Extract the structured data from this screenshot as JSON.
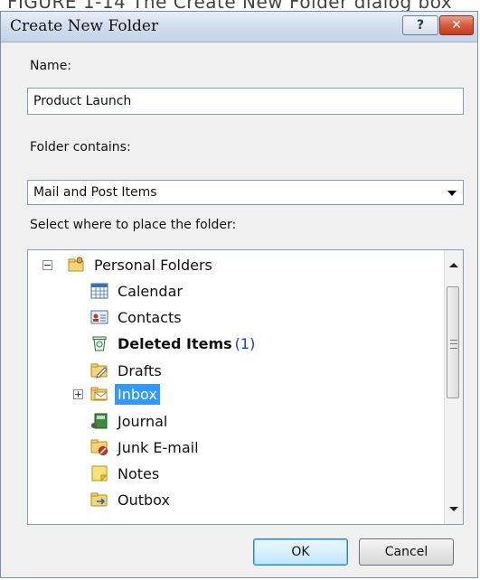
{
  "caption": "FIGURE 1-14 The Create New Folder dialog box",
  "window": {
    "title": "Create New Folder",
    "help_label": "?",
    "close_label": "✕"
  },
  "name_field": {
    "label": "Name:",
    "value": "Product Launch"
  },
  "folder_contains": {
    "label": "Folder contains:",
    "selected": "Mail and Post Items"
  },
  "location": {
    "label": "Select where to place the folder:",
    "tree": {
      "root": {
        "label": "Personal Folders",
        "icon": "personal-folders-icon",
        "expanded": true
      },
      "items": [
        {
          "label": "Calendar",
          "icon": "calendar-icon",
          "bold": false,
          "count": "",
          "selected": false,
          "expandable": false
        },
        {
          "label": "Contacts",
          "icon": "contacts-icon",
          "bold": false,
          "count": "",
          "selected": false,
          "expandable": false
        },
        {
          "label": "Deleted Items",
          "icon": "deleted-items-icon",
          "bold": true,
          "count": "(1)",
          "selected": false,
          "expandable": false
        },
        {
          "label": "Drafts",
          "icon": "drafts-icon",
          "bold": false,
          "count": "",
          "selected": false,
          "expandable": false
        },
        {
          "label": "Inbox",
          "icon": "inbox-icon",
          "bold": false,
          "count": "",
          "selected": true,
          "expandable": true
        },
        {
          "label": "Journal",
          "icon": "journal-icon",
          "bold": false,
          "count": "",
          "selected": false,
          "expandable": false
        },
        {
          "label": "Junk E-mail",
          "icon": "junk-email-icon",
          "bold": false,
          "count": "",
          "selected": false,
          "expandable": false
        },
        {
          "label": "Notes",
          "icon": "notes-icon",
          "bold": false,
          "count": "",
          "selected": false,
          "expandable": false
        },
        {
          "label": "Outbox",
          "icon": "outbox-icon",
          "bold": false,
          "count": "",
          "selected": false,
          "expandable": false
        }
      ]
    }
  },
  "buttons": {
    "ok": "OK",
    "cancel": "Cancel"
  },
  "colors": {
    "selection": "#3399ff",
    "unread_count": "#1d3fc7"
  }
}
